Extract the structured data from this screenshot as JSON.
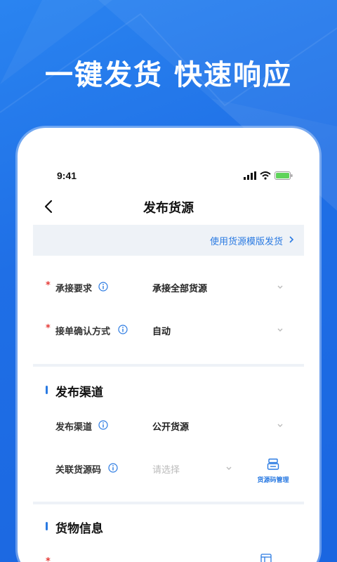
{
  "headline": "一键发货 快速响应",
  "status_bar": {
    "time": "9:41"
  },
  "nav": {
    "title": "发布货源"
  },
  "template_link": {
    "label": "使用货源模版发货"
  },
  "requirements": [
    {
      "label": "承接要求",
      "required": true,
      "value": "承接全部货源"
    },
    {
      "label": "接单确认方式",
      "required": true,
      "value": "自动"
    }
  ],
  "publish_section": {
    "title": "发布渠道",
    "rows": [
      {
        "label": "发布渠道",
        "value": "公开货源"
      },
      {
        "label": "关联货源码",
        "placeholder": "请选择"
      }
    ],
    "code_manage_label": "货源码管理"
  },
  "goods_section": {
    "title": "货物信息"
  },
  "colors": {
    "brand_blue": "#1f6fe6",
    "link_blue": "#2a7ae2",
    "required_red": "#e53935"
  }
}
